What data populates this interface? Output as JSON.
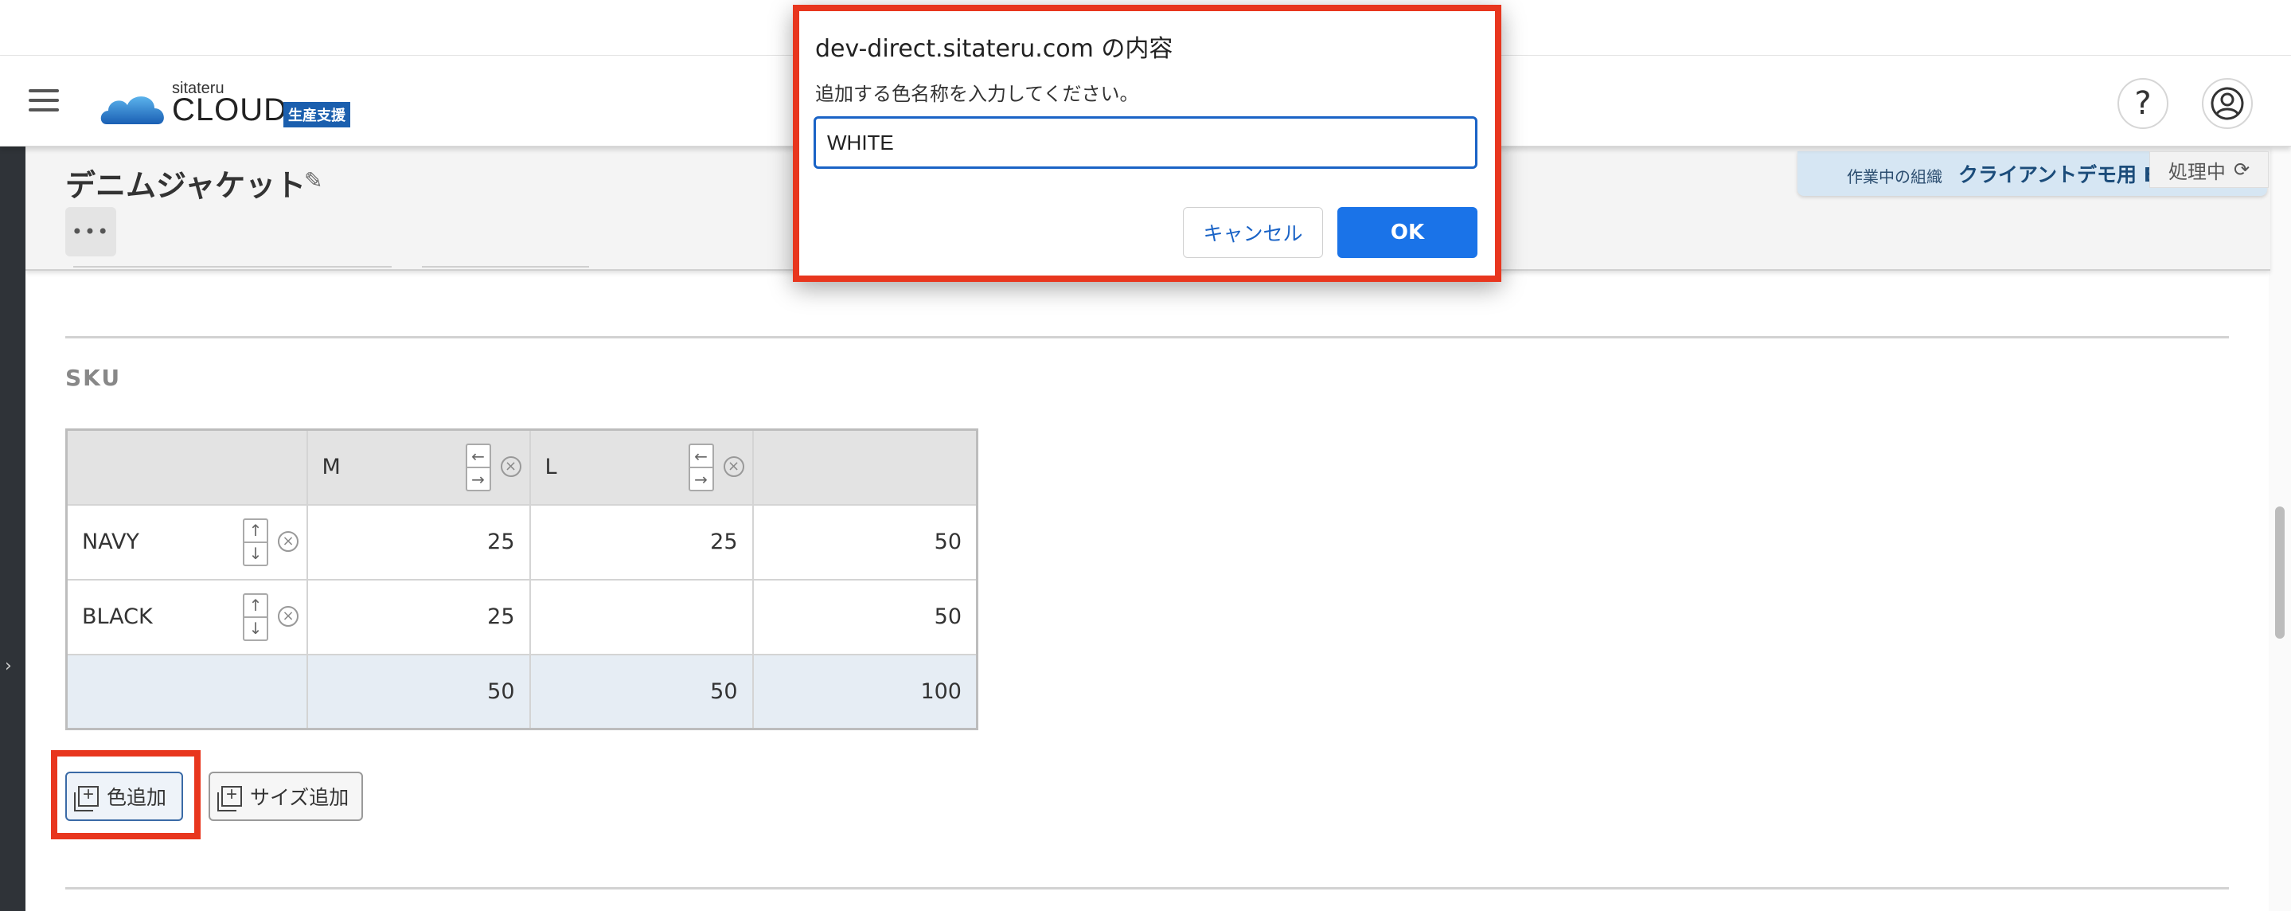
{
  "header": {
    "logo_sub": "sitateru",
    "logo_main": "CLOUD",
    "logo_badge": "生産支援",
    "help_glyph": "?"
  },
  "page": {
    "title": "デニムジャケット",
    "more_glyph": "•••"
  },
  "org_banner": {
    "label": "作業中の組織",
    "value": "クライアントデモ用 BRAND"
  },
  "status": {
    "processing": "処理中",
    "refresh_glyph": "⟳"
  },
  "sku": {
    "heading": "SKU",
    "columns": [
      "",
      "M",
      "L",
      ""
    ],
    "rows": [
      {
        "color": "NAVY",
        "values": [
          "25",
          "25",
          "50"
        ]
      },
      {
        "color": "BLACK",
        "values": [
          "25",
          "",
          "50"
        ]
      }
    ],
    "totals": [
      "",
      "50",
      "50",
      "100"
    ]
  },
  "actions": {
    "add_color": "色追加",
    "add_size": "サイズ追加"
  },
  "dialog": {
    "title": "dev-direct.sitateru.com の内容",
    "message": "追加する色名称を入力してください。",
    "input_value": "WHITE",
    "cancel_label": "キャンセル",
    "ok_label": "OK"
  },
  "colors": {
    "primary": "#1a73e8",
    "highlight": "#e8361e",
    "brand_badge": "#1b5fae"
  },
  "icons": {
    "menu": "hamburger-menu-icon",
    "help": "question-mark-icon",
    "user": "user-account-icon",
    "edit": "pencil-icon",
    "refresh": "refresh-icon",
    "remove": "close-circle-icon",
    "add": "add-box-icon"
  }
}
